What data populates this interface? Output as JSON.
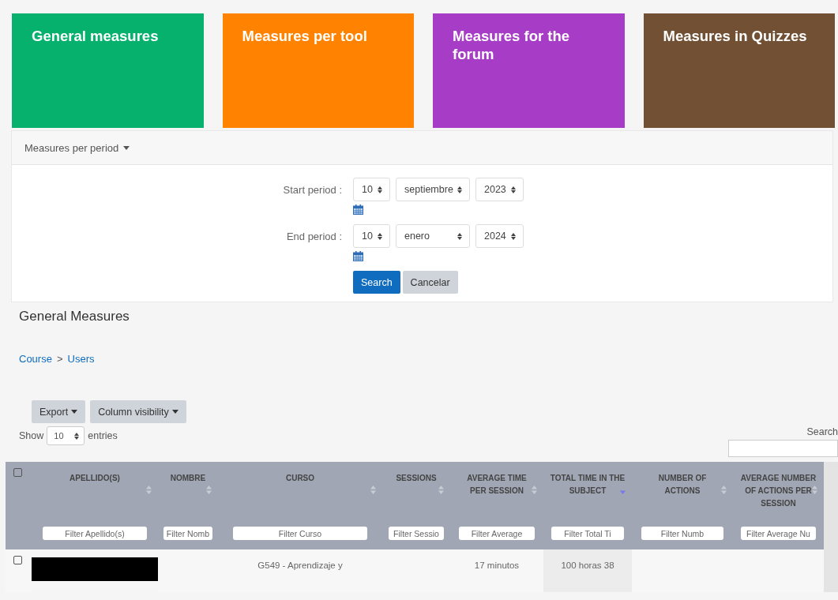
{
  "cards": [
    {
      "full": "General measures",
      "color": "#06b06d"
    },
    {
      "full": "Measures per tool",
      "color": "#ff8300"
    },
    {
      "full": "Measures for the forum",
      "color": "#a73cc6"
    },
    {
      "full": "Measures in Quizzes",
      "color": "#725034"
    }
  ],
  "period_panel": {
    "title": "Measures per period",
    "expanded": true,
    "rows": [
      {
        "label": "Start period :",
        "day": "10",
        "month": "septiembre",
        "year": "2023"
      },
      {
        "label": "End period :",
        "day": "10",
        "month": "enero",
        "year": "2024"
      }
    ],
    "buttons": [
      {
        "label": "Search",
        "kind": "primary"
      },
      {
        "label": "Cancelar",
        "kind": "secondary"
      }
    ]
  },
  "section_title": "General Measures",
  "breadcrumb": [
    {
      "label": "Course"
    },
    {
      "label": "Users"
    }
  ],
  "breadcrumb_separator": ">",
  "toolbar": [
    {
      "label": "Export"
    },
    {
      "label": "Column visibility"
    }
  ],
  "length": {
    "before": "Show",
    "value": "10",
    "after": "entries"
  },
  "search_label": "Search",
  "table": {
    "select_all_checked": false,
    "columns": [
      {
        "label": "APELLIDO(S)",
        "sorted": false,
        "placeholder": "Filter Apellido(s)"
      },
      {
        "label": "NOMBRE",
        "sorted": false,
        "placeholder": "Filter Nomb"
      },
      {
        "label": "CURSO",
        "sorted": false,
        "placeholder": "Filter Curso"
      },
      {
        "label": "SESSIONS",
        "sorted": false,
        "placeholder": "Filter Sessio"
      },
      {
        "label": "AVERAGE TIME PER SESSION",
        "sorted": false,
        "placeholder": "Filter Average"
      },
      {
        "label": "TOTAL TIME IN THE SUBJECT",
        "sorted": true,
        "placeholder": "Filter Total Ti"
      },
      {
        "label": "NUMBER OF ACTIONS",
        "sorted": false,
        "placeholder": "Filter Numb"
      },
      {
        "label": "AVERAGE NUMBER OF ACTIONS PER SESSION",
        "sorted": false,
        "placeholder": "Filter Average Nu"
      }
    ],
    "rows": [
      {
        "checked": false,
        "cells": [
          {
            "kind": "redacted"
          },
          {
            "kind": "empty"
          },
          {
            "kind": "text",
            "text": "G549 - Aprendizaje y"
          },
          {
            "kind": "empty"
          },
          {
            "kind": "text",
            "text": "17 minutos"
          },
          {
            "kind": "text",
            "text": "100 horas 38"
          },
          {
            "kind": "empty"
          },
          {
            "kind": "empty"
          }
        ]
      }
    ]
  }
}
